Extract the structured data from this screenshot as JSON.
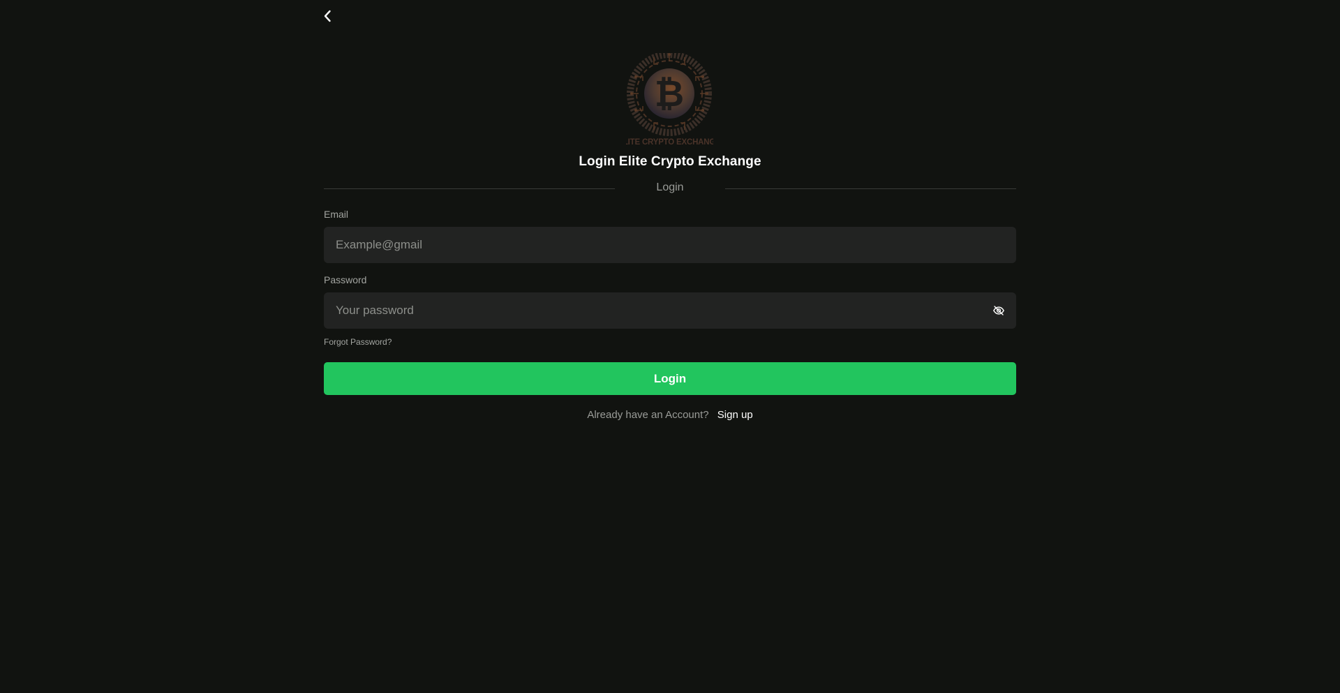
{
  "nav": {
    "back_icon": "chevron-left-icon"
  },
  "logo": {
    "alt": "Elite Crypto Exchange logo",
    "wordmark": "ELITE CRYPTO EXCHANGE",
    "symbol": "₿"
  },
  "header": {
    "title": "Login Elite Crypto Exchange"
  },
  "divider": {
    "label": "Login"
  },
  "form": {
    "email": {
      "label": "Email",
      "placeholder": "Example@gmail",
      "value": ""
    },
    "password": {
      "label": "Password",
      "placeholder": "Your password",
      "value": "",
      "toggle_icon": "eye-off-icon"
    },
    "forgot_label": "Forgot Password?",
    "submit_label": "Login"
  },
  "footer": {
    "prompt": "Already have an Account?",
    "signup_label": "Sign up"
  },
  "colors": {
    "background": "#111310",
    "input_bg": "#222322",
    "accent": "#22c55e",
    "muted_text": "#9a9c98"
  }
}
